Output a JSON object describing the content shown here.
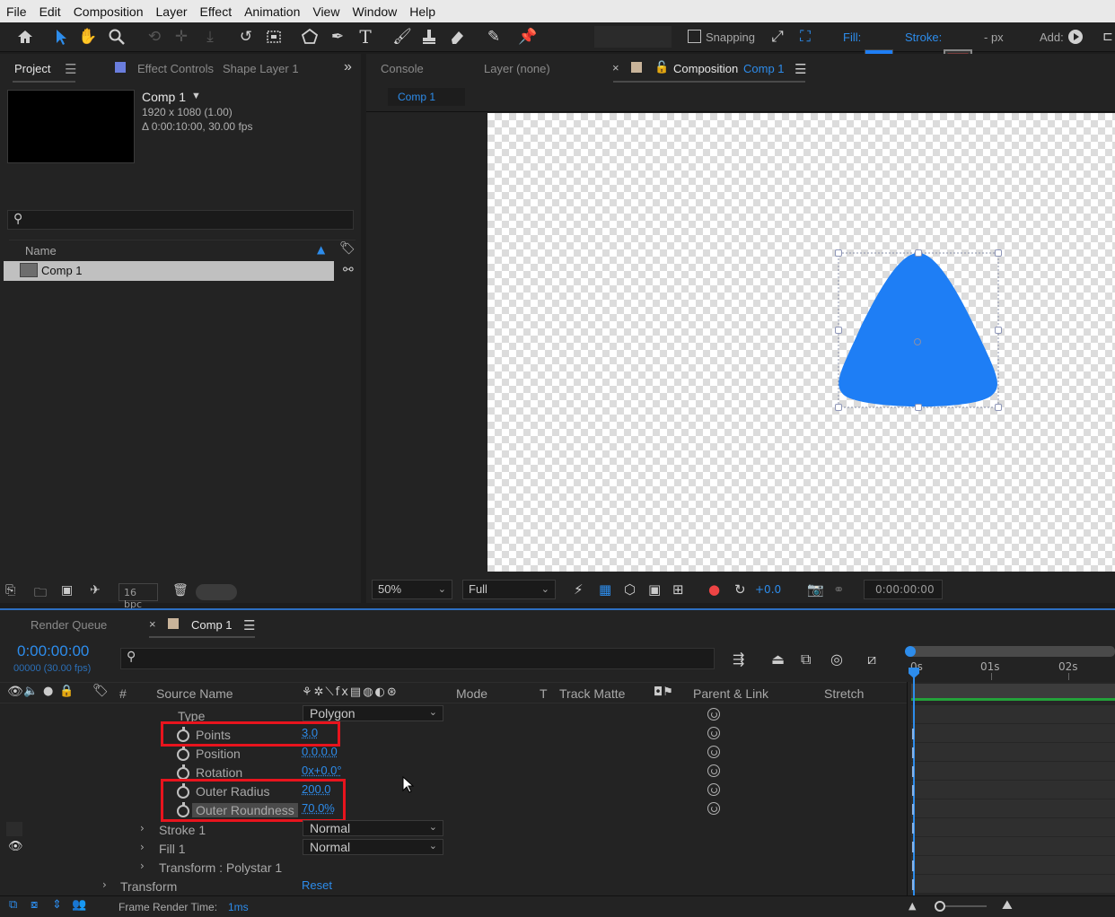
{
  "menu": [
    "File",
    "Edit",
    "Composition",
    "Layer",
    "Effect",
    "Animation",
    "View",
    "Window",
    "Help"
  ],
  "toolbar": {
    "snapping_label": "Snapping",
    "fill_label": "Fill:",
    "stroke_label": "Stroke:",
    "stroke_unit": "- px",
    "add_label": "Add:",
    "fill_color": "#1e7ef5"
  },
  "project_panel": {
    "tab_project": "Project",
    "tab_effect_controls": "Effect Controls",
    "effect_controls_layer": "Shape Layer 1",
    "comp_name": "Comp 1",
    "comp_size": "1920 x 1080 (1.00)",
    "comp_duration": "Δ 0:00:10:00, 30.00 fps",
    "col_name": "Name",
    "item": "Comp 1",
    "bpc": "16 bpc"
  },
  "comp_panel": {
    "tab_console": "Console",
    "tab_layer": "Layer (none)",
    "tab_composition": "Composition",
    "tab_composition_name": "Comp 1",
    "subtab": "Comp 1",
    "zoom": "50%",
    "resolution": "Full",
    "exposure": "+0.0",
    "timecode": "0:00:00:00"
  },
  "timeline": {
    "tab_render_queue": "Render Queue",
    "tab_comp": "Comp 1",
    "current_time": "0:00:00:00",
    "frame_info": "00000 (30.00 fps)",
    "col_source_name": "Source Name",
    "col_mode": "Mode",
    "col_t": "T",
    "col_track_matte": "Track Matte",
    "col_parent": "Parent & Link",
    "col_stretch": "Stretch",
    "col_hash": "#",
    "ruler": [
      "0s",
      "01s",
      "02s"
    ],
    "props": [
      {
        "label": "Type",
        "value": "Polygon"
      },
      {
        "label": "Points",
        "value": "3.0"
      },
      {
        "label": "Position",
        "value": "0.0,0.0"
      },
      {
        "label": "Rotation",
        "value": "0x+0.0°"
      },
      {
        "label": "Outer Radius",
        "value": "200.0"
      },
      {
        "label": "Outer Roundness",
        "value": "70.0%"
      }
    ],
    "groups": [
      {
        "label": "Stroke 1",
        "mode": "Normal"
      },
      {
        "label": "Fill 1",
        "mode": "Normal"
      },
      {
        "label": "Transform : Polystar 1"
      }
    ],
    "transform_label": "Transform",
    "reset_label": "Reset",
    "frame_render_label": "Frame Render Time:",
    "frame_render_value": "1ms"
  }
}
